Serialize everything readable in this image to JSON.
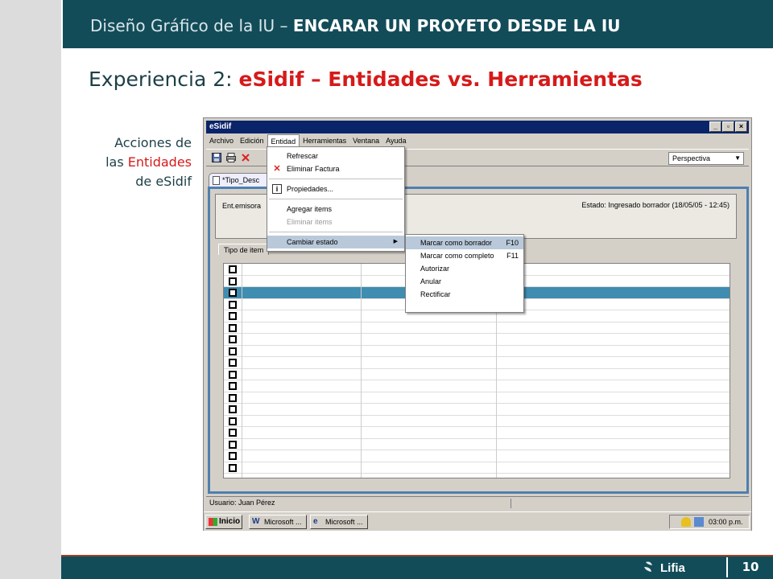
{
  "slide": {
    "header_prefix": "Diseño Gráfico de la IU – ",
    "header_bold": "ENCARAR UN PROYETO DESDE LA IU",
    "title_prefix": "Experiencia 2: ",
    "title_highlight": "eSidif – Entidades vs. Herramientas",
    "note_line1": "Acciones de",
    "note_line2_prefix": "las ",
    "note_line2_highlight": "Entidades",
    "note_line3": "de eSidif",
    "logo_text": "Lifia",
    "page_number": "10",
    "colors": {
      "brand": "#134c59",
      "accent": "#d61a1a",
      "strip": "#dcdcdc"
    }
  },
  "app": {
    "window_title": "eSidif",
    "window_buttons": [
      "_",
      "▫",
      "×"
    ],
    "menubar": [
      "Archivo",
      "Edición",
      "Entidad",
      "Herramientas",
      "Ventana",
      "Ayuda"
    ],
    "toolbar_icons": [
      "save-icon",
      "print-icon",
      "delete-icon"
    ],
    "perspective_label": "Perspectiva",
    "editor_tab": "*Tipo_Desc",
    "ent_label": "Ent.emisora",
    "estado_text": "Estado: Ingresado borrador  (18/05/05 - 12:45)",
    "tabs": [
      "Tipo de item",
      "",
      ""
    ],
    "grid_rows": 18,
    "grid_highlight_row": 2,
    "status_text": "Usuario: Juan Pérez",
    "taskbar": {
      "start_label": "Inicio",
      "buttons": [
        "Microsoft ...",
        "Microsoft ..."
      ],
      "clock": "03:00 p.m."
    }
  },
  "menu_entidad": {
    "items": [
      {
        "label": "Refrescar",
        "icon": "",
        "disabled": false
      },
      {
        "label": "Eliminar Factura",
        "icon": "red-x-icon",
        "disabled": false
      },
      {
        "label": "Propiedades...",
        "icon": "info-icon",
        "disabled": false
      },
      {
        "label": "Agregar items",
        "icon": "",
        "disabled": false
      },
      {
        "label": "Eliminar items",
        "icon": "",
        "disabled": true
      },
      {
        "label": "Cambiar estado",
        "icon": "",
        "disabled": false,
        "submenu": true
      }
    ]
  },
  "menu_estado": {
    "items": [
      {
        "label": "Marcar como borrador",
        "key": "F10"
      },
      {
        "label": "Marcar como completo",
        "key": "F11"
      },
      {
        "label": "Autorizar",
        "key": ""
      },
      {
        "label": "Anular",
        "key": ""
      },
      {
        "label": "Rectificar",
        "key": ""
      }
    ]
  }
}
